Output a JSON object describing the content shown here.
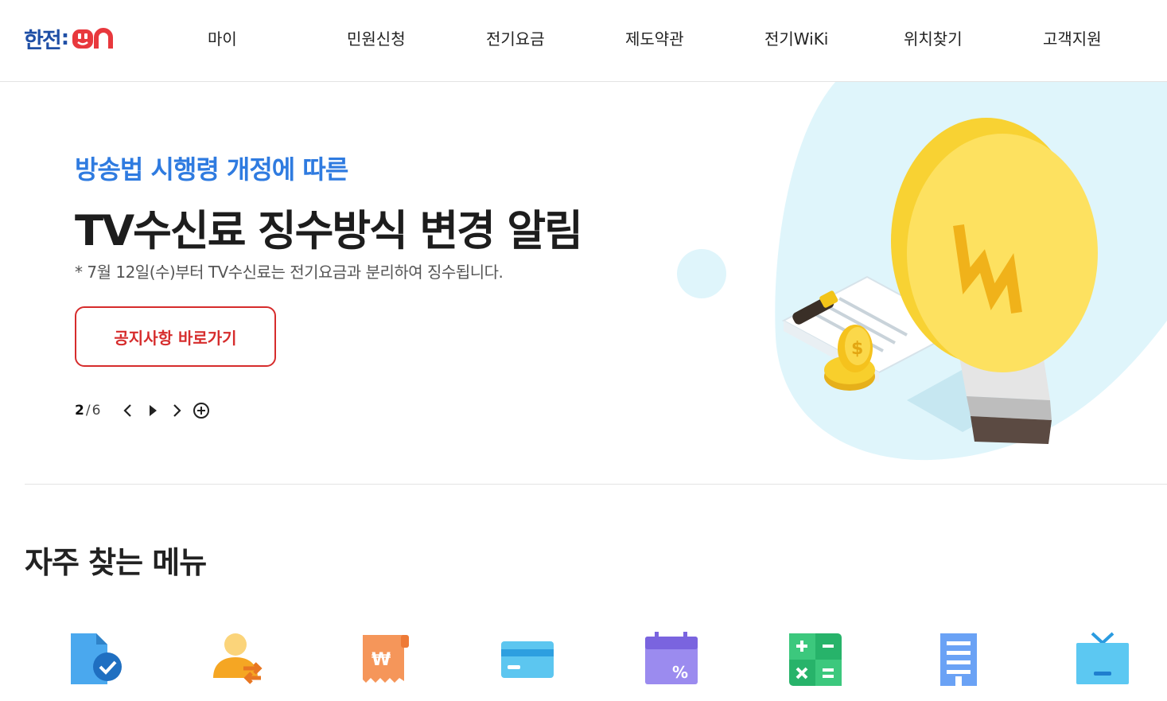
{
  "header": {
    "logo_text": "한전",
    "logo_on": "on",
    "nav": [
      "마이",
      "민원신청",
      "전기요금",
      "제도약관",
      "전기WiKi",
      "위치찾기",
      "고객지원"
    ]
  },
  "hero": {
    "subtitle": "방송법 시행령 개정에 따른",
    "title": "TV수신료 징수방식 변경 알림",
    "description": "* 7월 12일(수)부터 TV수신료는 전기요금과 분리하여 징수됩니다.",
    "button_label": "공지사항 바로가기",
    "pager": {
      "current": "2",
      "separator": "/",
      "total": "6"
    }
  },
  "quick_menu": {
    "title": "자주 찾는 메뉴",
    "icons": [
      "document-check-icon",
      "person-transfer-icon",
      "bill-won-icon",
      "credit-card-icon",
      "calendar-percent-icon",
      "calculator-icon",
      "building-icon",
      "tv-icon"
    ]
  },
  "colors": {
    "brand_blue": "#1f4fa6",
    "brand_red": "#e8383d",
    "accent_blue": "#2f7be0",
    "button_red": "#d62c2c"
  }
}
